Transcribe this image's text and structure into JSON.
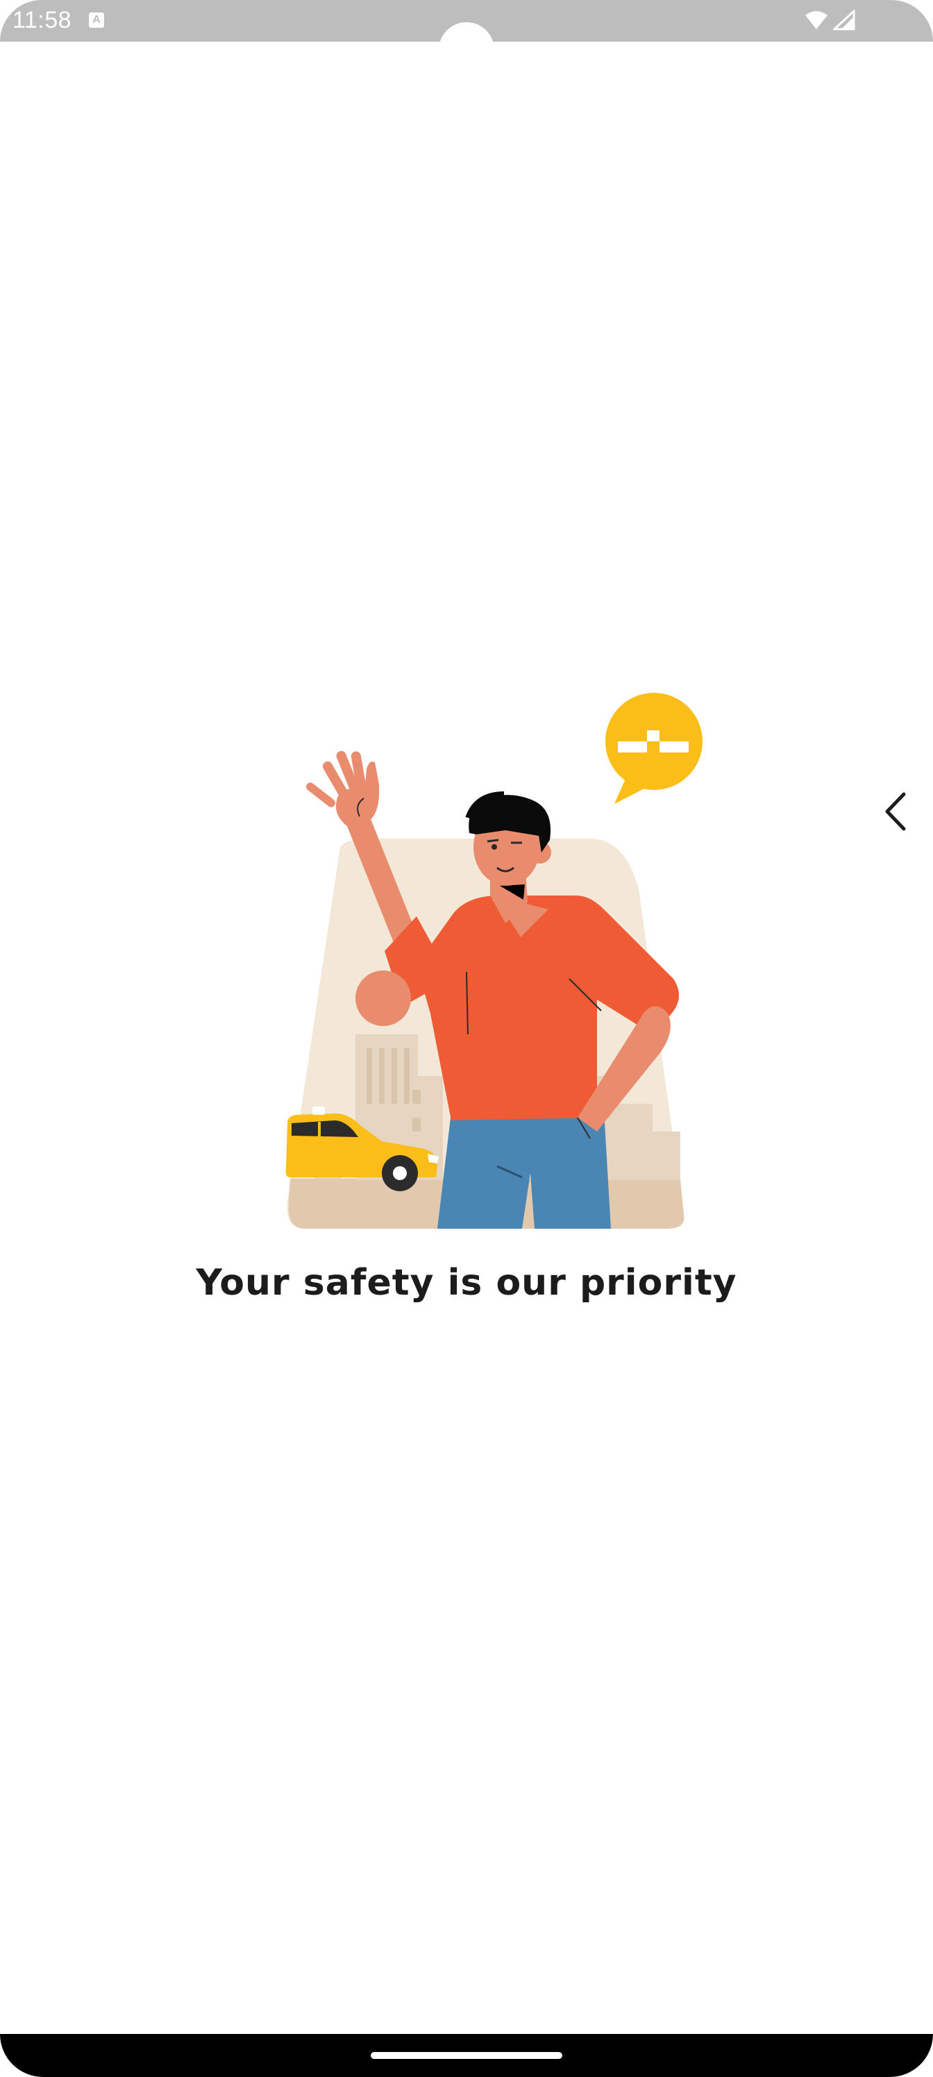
{
  "status_bar": {
    "time": "11:58",
    "notification_icon": "a-icon",
    "wifi_icon": "wifi-icon",
    "signal_icon": "signal-icon",
    "background_color": "#bdbdbd"
  },
  "onboarding": {
    "illustration": "man-waving-taxi-illustration",
    "title": "Your safety is our priority",
    "back_icon": "chevron-left-icon"
  },
  "colors": {
    "accent_yellow": "#fbbd18",
    "shirt_orange": "#ee5b35",
    "jeans_blue": "#4a86b4",
    "background_beige": "#f3e7d8",
    "text": "#1c1c1c"
  },
  "navigation_bar": {
    "home_indicator": "home-indicator"
  }
}
